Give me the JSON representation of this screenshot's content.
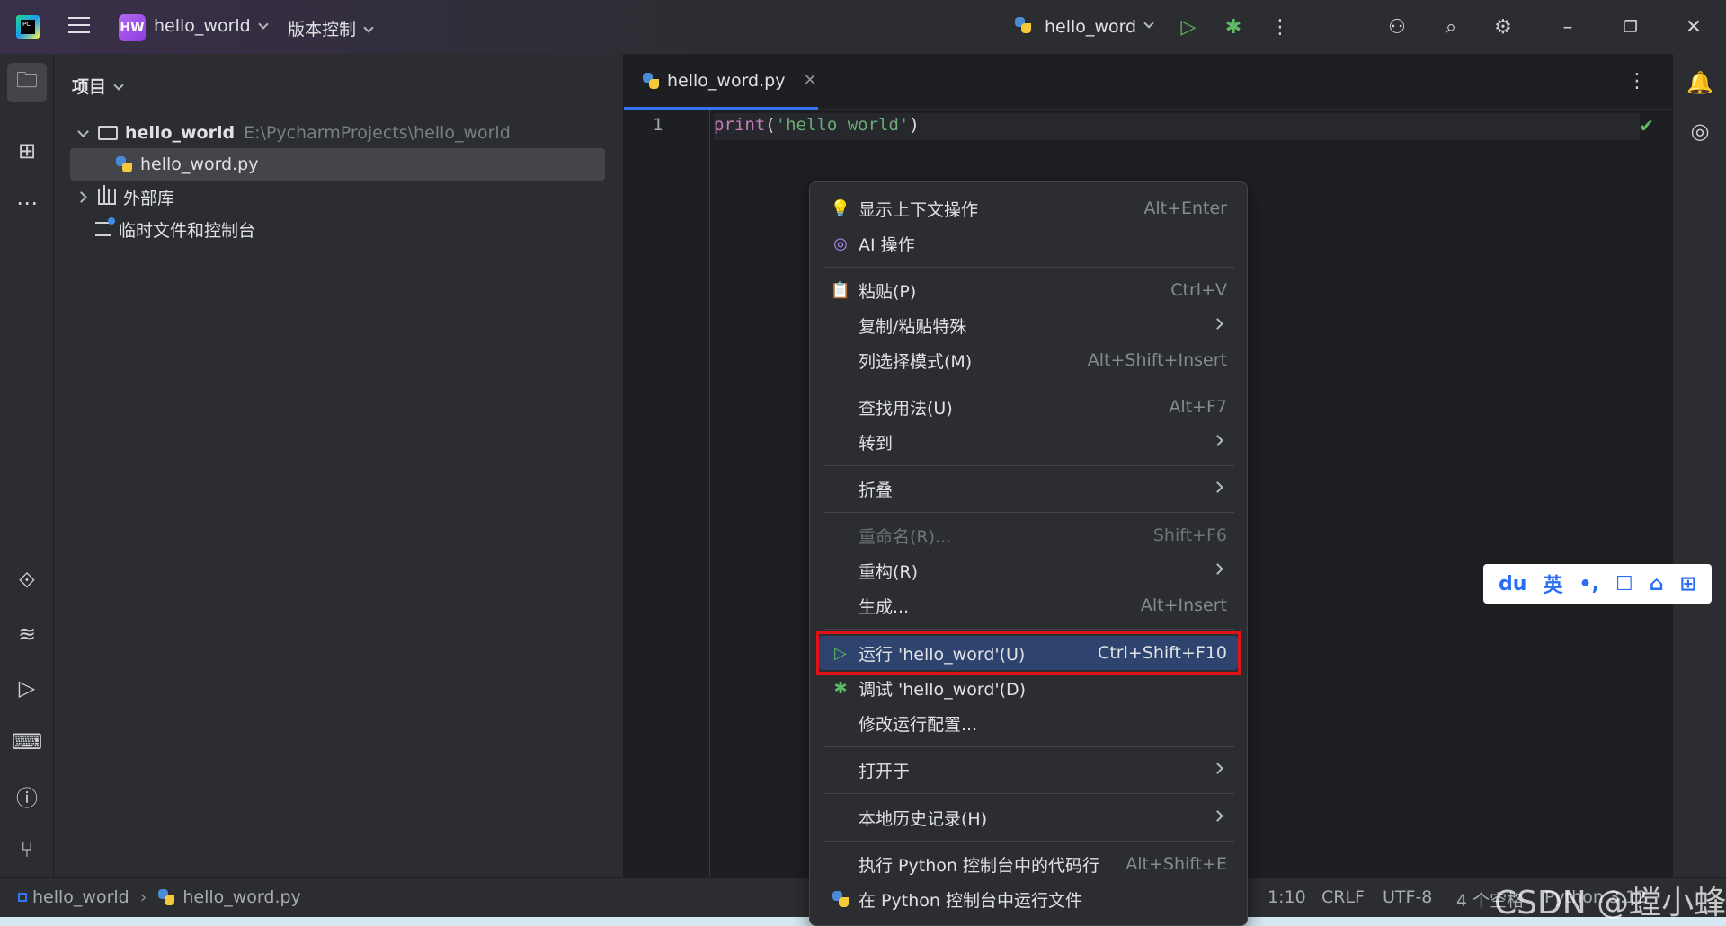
{
  "titlebar": {
    "project_badge": "HW",
    "project_name": "hello_world",
    "vcs_label": "版本控制",
    "run_config": "hello_word"
  },
  "project_panel": {
    "title": "项目",
    "root_name": "hello_world",
    "root_path": "E:\\PycharmProjects\\hello_world",
    "file": "hello_word.py",
    "external_libs": "外部库",
    "scratches": "临时文件和控制台"
  },
  "editor": {
    "tab_label": "hello_word.py",
    "line_number": "1",
    "code_fn": "print",
    "code_open": "(",
    "code_str": "'hello world'",
    "code_close": ")"
  },
  "context_menu": {
    "items": [
      {
        "label": "显示上下文操作",
        "shortcut": "Alt+Enter"
      },
      {
        "label": "AI 操作",
        "shortcut": ""
      },
      {
        "label": "粘贴(P)",
        "shortcut": "Ctrl+V"
      },
      {
        "label": "复制/粘贴特殊",
        "shortcut": ""
      },
      {
        "label": "列选择模式(M)",
        "shortcut": "Alt+Shift+Insert"
      },
      {
        "label": "查找用法(U)",
        "shortcut": "Alt+F7"
      },
      {
        "label": "转到",
        "shortcut": ""
      },
      {
        "label": "折叠",
        "shortcut": ""
      },
      {
        "label": "重命名(R)...",
        "shortcut": "Shift+F6"
      },
      {
        "label": "重构(R)",
        "shortcut": ""
      },
      {
        "label": "生成...",
        "shortcut": "Alt+Insert"
      },
      {
        "label": "运行 'hello_word'(U)",
        "shortcut": "Ctrl+Shift+F10"
      },
      {
        "label": "调试 'hello_word'(D)",
        "shortcut": ""
      },
      {
        "label": "修改运行配置...",
        "shortcut": ""
      },
      {
        "label": "打开于",
        "shortcut": ""
      },
      {
        "label": "本地历史记录(H)",
        "shortcut": ""
      },
      {
        "label": "执行 Python 控制台中的代码行",
        "shortcut": "Alt+Shift+E"
      },
      {
        "label": "在 Python 控制台中运行文件",
        "shortcut": ""
      }
    ]
  },
  "statusbar": {
    "crumb_project": "hello_world",
    "crumb_file": "hello_word.py",
    "position": "1:10",
    "line_sep": "CRLF",
    "encoding": "UTF-8",
    "indent": "4 个空格",
    "interpreter": "Python 3.12"
  },
  "ime": {
    "lang": "英"
  },
  "watermark": "CSDN @螳小蜂",
  "colors": {
    "accent": "#3574f0",
    "highlight_row": "#2e436e",
    "annotation_red": "#e0121a"
  }
}
